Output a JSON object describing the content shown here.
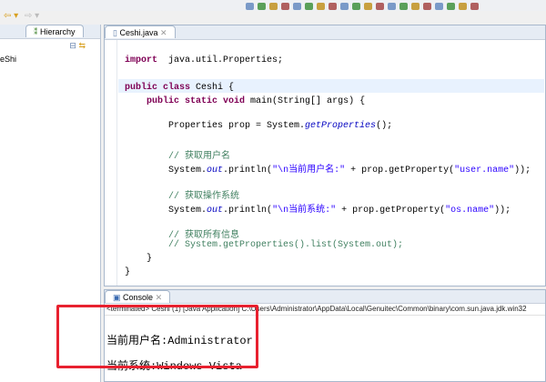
{
  "nav": {
    "back": "⇦ ▾",
    "forward": "⇨ ▾"
  },
  "left_panel": {
    "tab_hierarchy": "Hierarchy",
    "tree_item": "eShi"
  },
  "editor": {
    "tab": "Ceshi.java",
    "lines": [
      {
        "parts": [
          [
            "kw",
            "import"
          ],
          [
            "",
            "  java.util.Properties;"
          ]
        ]
      },
      {
        "parts": [
          [
            "kw",
            "public class"
          ],
          [
            "",
            " Ceshi {"
          ]
        ]
      },
      {
        "parts": [
          [
            "",
            "    "
          ],
          [
            "kw",
            "public static void"
          ],
          [
            "",
            " main(String[] args) {"
          ]
        ]
      },
      {
        "parts": [
          [
            "",
            "        Properties prop = System."
          ],
          [
            "it",
            "getProperties"
          ],
          [
            "",
            "();"
          ]
        ]
      },
      {
        "parts": [
          [
            "cm",
            "        // 获取用户名"
          ]
        ]
      },
      {
        "parts": [
          [
            "",
            "        System."
          ],
          [
            "it",
            "out"
          ],
          [
            "",
            ".println("
          ],
          [
            "st",
            "\"\\n当前用户名:\""
          ],
          [
            "",
            " + prop.getProperty("
          ],
          [
            "st",
            "\"user.name\""
          ],
          [
            "",
            "));"
          ]
        ]
      },
      {
        "parts": [
          [
            "cm",
            "        // 获取操作系统"
          ]
        ]
      },
      {
        "parts": [
          [
            "",
            "        System."
          ],
          [
            "it",
            "out"
          ],
          [
            "",
            ".println("
          ],
          [
            "st",
            "\"\\n当前系统:\""
          ],
          [
            "",
            " + prop.getProperty("
          ],
          [
            "st",
            "\"os.name\""
          ],
          [
            "",
            "));"
          ]
        ]
      },
      {
        "parts": [
          [
            "cm",
            "        // 获取所有信息"
          ]
        ]
      },
      {
        "parts": [
          [
            "cm",
            "        // System.getProperties().list(System.out);"
          ]
        ]
      },
      {
        "parts": [
          [
            "",
            "    }"
          ]
        ]
      },
      {
        "parts": [
          [
            "",
            "}"
          ]
        ]
      }
    ]
  },
  "console": {
    "tab": "Console",
    "info": "<terminated> Ceshi (1) [Java Application] C:\\Users\\Administrator\\AppData\\Local\\Genuitec\\Common\\binary\\com.sun.java.jdk.win32",
    "output": [
      "当前用户名:Administrator",
      "当前系统:Windows Vista"
    ]
  },
  "colors": {
    "highlight_box": "#e8212f"
  }
}
